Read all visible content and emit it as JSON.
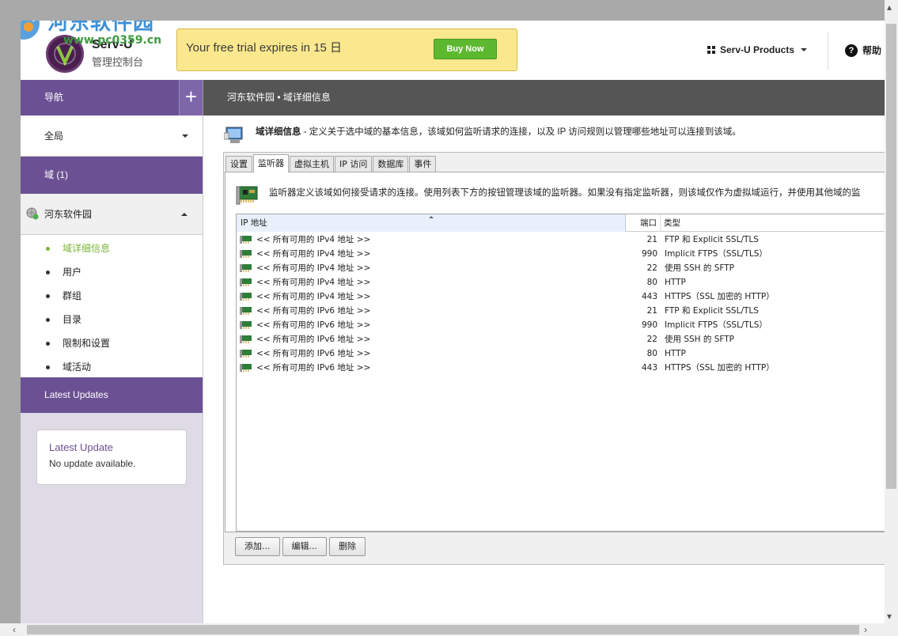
{
  "watermark": {
    "title": "河东软件园",
    "url": "www.pc0359.cn"
  },
  "header": {
    "product_name": "Serv-U",
    "product_sub": "管理控制台",
    "trial_text": "Your free trial expires in 15 日",
    "buy_label": "Buy Now",
    "products_label": "Serv-U Products",
    "help_label": "帮助"
  },
  "sidebar": {
    "nav_label": "导航",
    "plus_label": "+",
    "global_label": "全局",
    "domain_label": "域 (1)",
    "domain_name": "河东软件园",
    "items": [
      {
        "label": "域详细信息",
        "active": true
      },
      {
        "label": "用户"
      },
      {
        "label": "群组"
      },
      {
        "label": "目录"
      },
      {
        "label": "限制和设置"
      },
      {
        "label": "域活动"
      }
    ],
    "latest_updates_label": "Latest Updates",
    "update_box": {
      "title": "Latest Update",
      "text": "No update available."
    }
  },
  "breadcrumb": "河东软件园 • 域详细信息",
  "info": {
    "title": "域详细信息",
    "text": " - 定义关于选中域的基本信息，该域如何监听请求的连接，以及 IP 访问规则以管理哪些地址可以连接到该域。"
  },
  "tabs": [
    "设置",
    "监听器",
    "虚拟主机",
    "IP 访问",
    "数据库",
    "事件"
  ],
  "active_tab": "监听器",
  "listeners": {
    "description": "监听器定义该域如何接受请求的连接。使用列表下方的按钮管理该域的监听器。如果没有指定监听器，则该域仅作为虚拟域运行，并使用其他域的监",
    "columns": {
      "ip": "IP 地址",
      "port": "端口",
      "type": "类型"
    },
    "rows": [
      {
        "ip": "<< 所有可用的 IPv4 地址 >>",
        "port": "21",
        "type": "FTP 和 Explicit SSL/TLS"
      },
      {
        "ip": "<< 所有可用的 IPv4 地址 >>",
        "port": "990",
        "type": "Implicit FTPS（SSL/TLS）"
      },
      {
        "ip": "<< 所有可用的 IPv4 地址 >>",
        "port": "22",
        "type": "使用 SSH 的 SFTP"
      },
      {
        "ip": "<< 所有可用的 IPv4 地址 >>",
        "port": "80",
        "type": "HTTP"
      },
      {
        "ip": "<< 所有可用的 IPv4 地址 >>",
        "port": "443",
        "type": "HTTPS（SSL 加密的 HTTP）"
      },
      {
        "ip": "<< 所有可用的 IPv6 地址 >>",
        "port": "21",
        "type": "FTP 和 Explicit SSL/TLS"
      },
      {
        "ip": "<< 所有可用的 IPv6 地址 >>",
        "port": "990",
        "type": "Implicit FTPS（SSL/TLS）"
      },
      {
        "ip": "<< 所有可用的 IPv6 地址 >>",
        "port": "22",
        "type": "使用 SSH 的 SFTP"
      },
      {
        "ip": "<< 所有可用的 IPv6 地址 >>",
        "port": "80",
        "type": "HTTP"
      },
      {
        "ip": "<< 所有可用的 IPv6 地址 >>",
        "port": "443",
        "type": "HTTPS（SSL 加密的 HTTP）"
      }
    ],
    "buttons": {
      "add": "添加...",
      "edit": "编辑...",
      "delete": "删除"
    }
  },
  "colors": {
    "purple": "#6b5193",
    "accent_green": "#7ab539",
    "buy_green": "#5cb82e",
    "trial_yellow": "#fbe88e"
  }
}
